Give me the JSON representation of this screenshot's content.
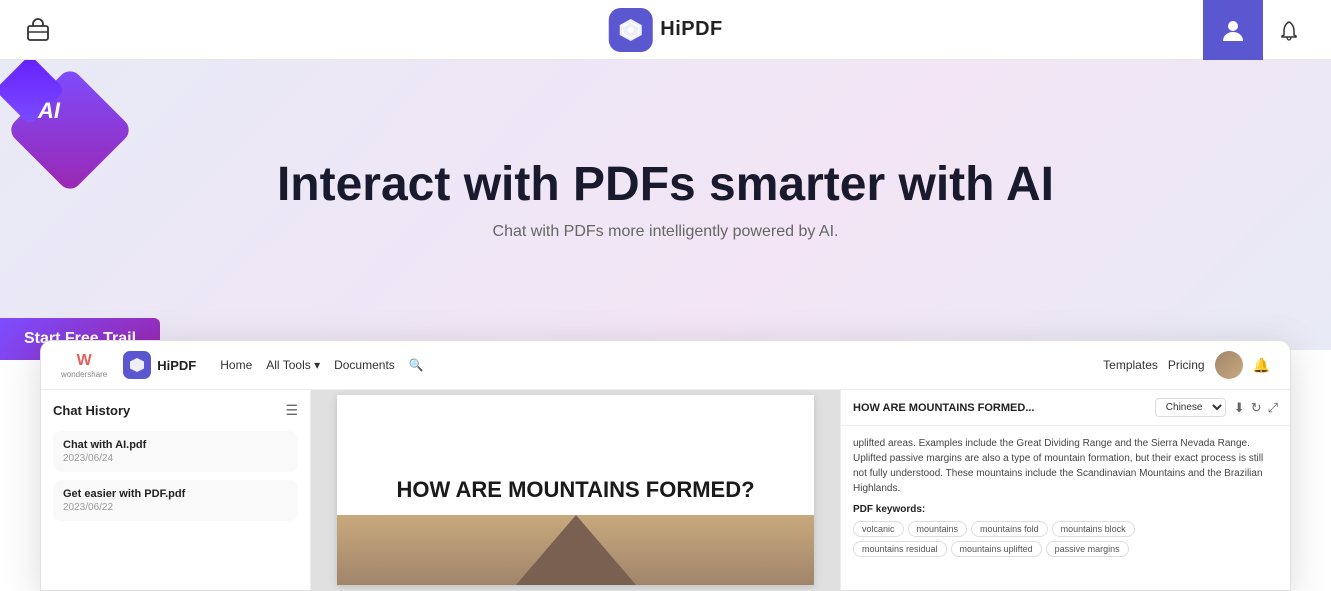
{
  "topNav": {
    "logoText": "HiPDF",
    "toolboxLabel": "toolbox"
  },
  "hero": {
    "aiLabel": "AI",
    "title": "Interact with PDFs smarter with AI",
    "subtitle": "Chat with PDFs more intelligently powered by AI.",
    "ctaButton": "Start Free Trail"
  },
  "previewNav": {
    "logoText": "HiPDF",
    "wondershareW": "W",
    "wondershareText": "wondershare",
    "links": [
      "Home",
      "All Tools",
      "Documents",
      "Templates",
      "Pricing"
    ],
    "allToolsHasDropdown": true
  },
  "chatSidebar": {
    "title": "Chat History",
    "items": [
      {
        "name": "Chat with AI.pdf",
        "date": "2023/06/24"
      },
      {
        "name": "Get easier with PDF.pdf",
        "date": "2023/06/22"
      }
    ]
  },
  "pdfView": {
    "title": "HOW ARE MOUNTAINS FORMED?"
  },
  "aiPanel": {
    "headerTitle": "HOW ARE MOUNTAINS FORMED...",
    "language": "Chinese",
    "bodyText": "uplifted areas. Examples include the Great Dividing Range and the Sierra Nevada Range. Uplifted passive margins are also a type of mountain formation, but their exact process is still not fully understood. These mountains include the Scandinavian Mountains and the Brazilian Highlands.",
    "keywordsLabel": "PDF keywords:",
    "keywords": [
      "volcanic",
      "mountains",
      "mountains fold",
      "mountains block"
    ],
    "keywords2": [
      "mountains residual",
      "mountains uplifted",
      "passive margins"
    ]
  }
}
